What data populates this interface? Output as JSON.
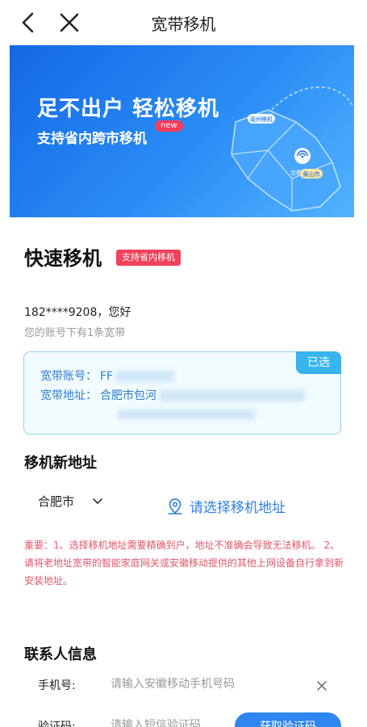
{
  "header": {
    "title": "宽带移机"
  },
  "banner": {
    "headline": "足不出户 轻松移机",
    "subline": "支持省内跨市移机",
    "new_badge": "new",
    "map_label_1": "亳州移机",
    "map_label_2": "黄山市",
    "map_label_3": "合肥"
  },
  "section": {
    "title": "快速移机",
    "tag": "支持省内移机"
  },
  "account": {
    "greeting": "182****9208，您好",
    "summary": "您的账号下有1条宽带"
  },
  "card": {
    "badge": "已选",
    "account_label": "宽带账号：",
    "account_value": "FF",
    "address_label": "宽带地址：",
    "address_value": "合肥市包河"
  },
  "new_address": {
    "title": "移机新地址",
    "city": "合肥市",
    "picker_label": "请选择移机地址"
  },
  "notice": "重要：1、选择移机地址需要精确到户，地址不准确会导致无法移机。 2、请将老地址宽带的智能家庭网关或安徽移动提供的其他上网设备自行拿到新安装地址。",
  "contact": {
    "title": "联系人信息",
    "phone_label": "手机号:",
    "phone_placeholder": "请输入安徽移动手机号码",
    "code_label": "验证码:",
    "code_placeholder": "请输入短信验证码",
    "code_button": "获取验证码"
  },
  "colors": {
    "primary": "#2e86f0",
    "selected_badge": "#38b4ee",
    "notice": "#e2566a",
    "tag": "#f0425a"
  }
}
